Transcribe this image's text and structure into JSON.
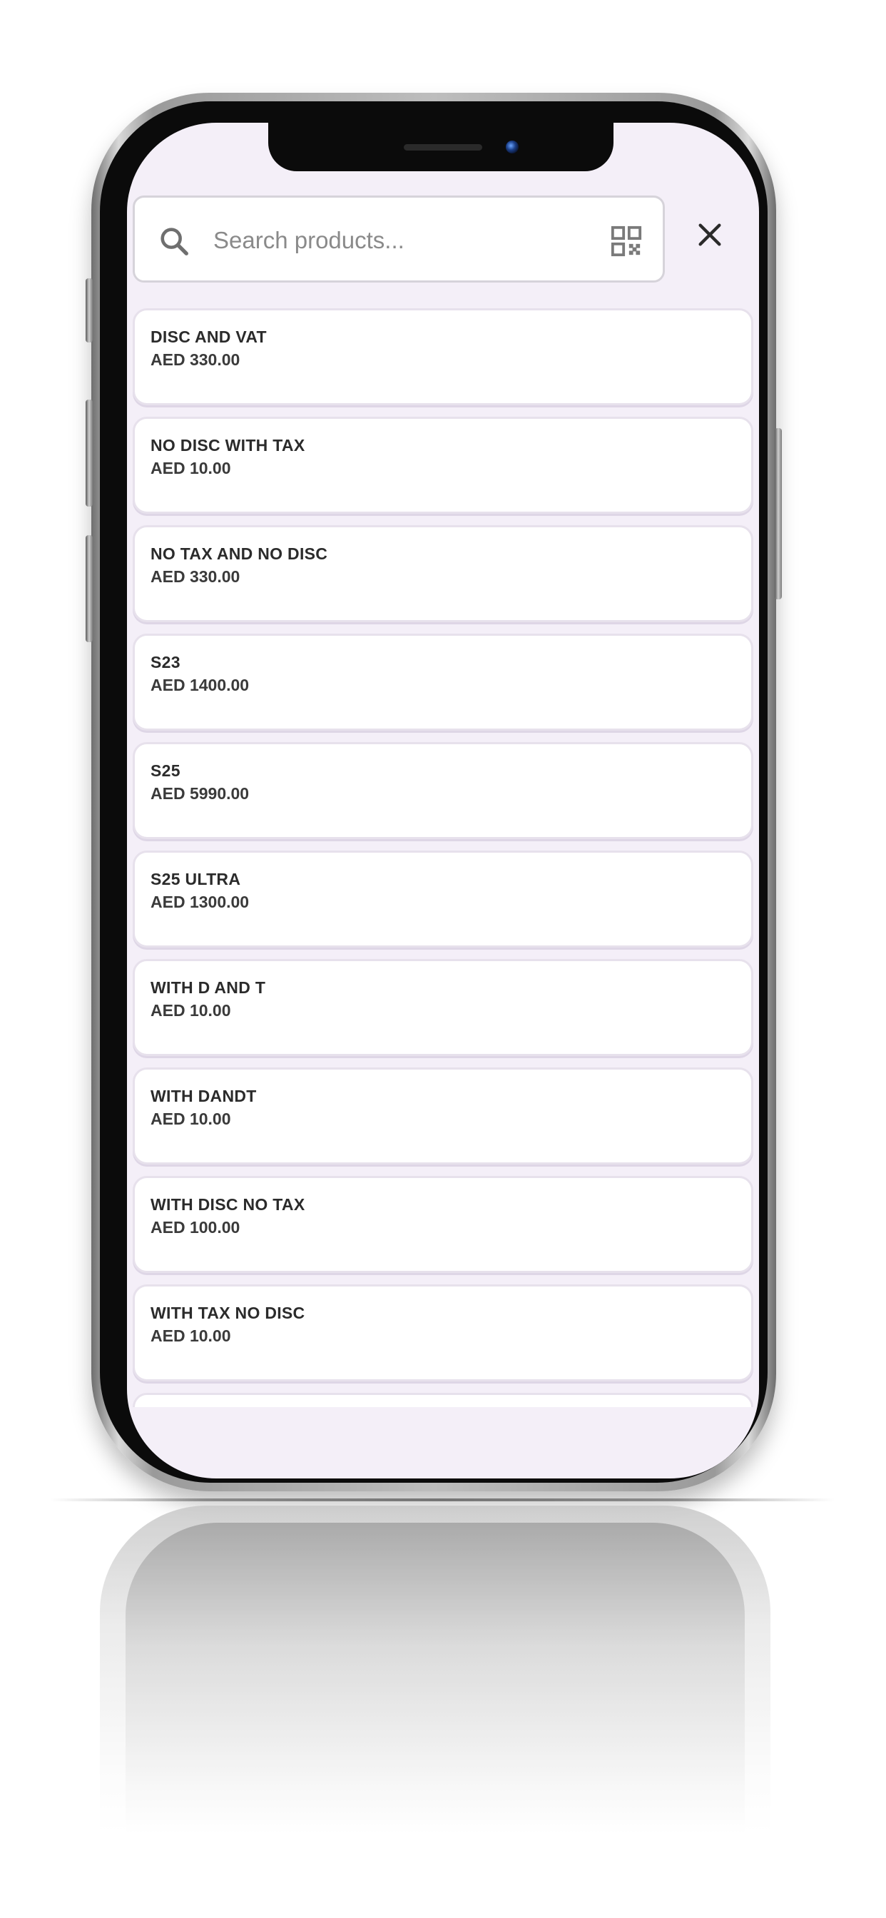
{
  "search": {
    "placeholder": "Search products...",
    "value": ""
  },
  "icons": {
    "search": "search-icon",
    "scan": "qr-code-icon",
    "close": "close-icon"
  },
  "products": [
    {
      "name": "DISC AND VAT",
      "price": "AED 330.00"
    },
    {
      "name": "NO DISC WITH TAX",
      "price": "AED 10.00"
    },
    {
      "name": "NO TAX AND NO DISC",
      "price": "AED 330.00"
    },
    {
      "name": "S23",
      "price": "AED 1400.00"
    },
    {
      "name": "S25",
      "price": "AED 5990.00"
    },
    {
      "name": "S25 ULTRA",
      "price": "AED 1300.00"
    },
    {
      "name": "WITH D AND T",
      "price": "AED 10.00"
    },
    {
      "name": "WITH DANDT",
      "price": "AED 10.00"
    },
    {
      "name": "WITH DISC NO TAX",
      "price": "AED 100.00"
    },
    {
      "name": "WITH TAX NO DISC",
      "price": "AED 10.00"
    },
    {
      "name": "",
      "price": ""
    }
  ],
  "colors": {
    "screen_background": "#f4eff8",
    "card_background": "#ffffff",
    "card_border": "#e7e1ec",
    "text_primary": "#2b2b2b",
    "placeholder": "#8a8a8a"
  }
}
